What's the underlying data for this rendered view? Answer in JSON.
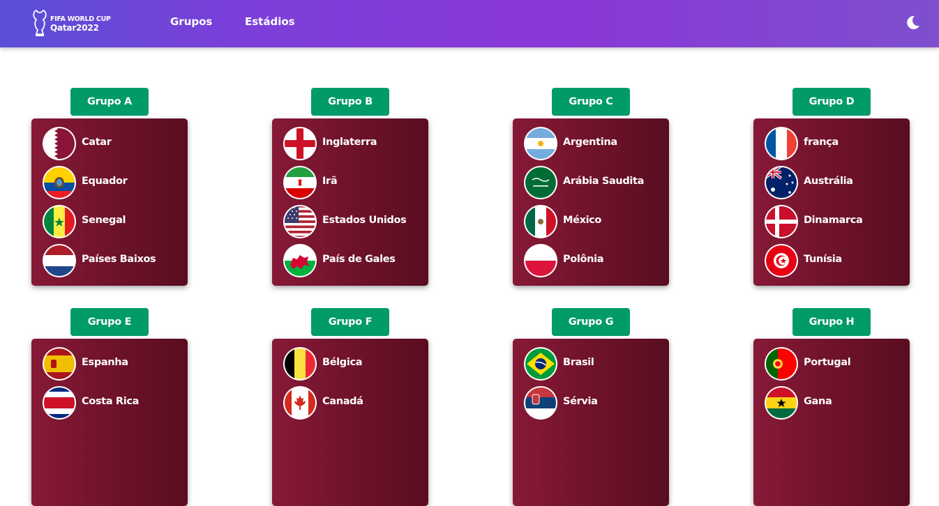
{
  "header": {
    "logo_line1": "FIFA WORLD CUP",
    "logo_line2": "Qatar2022",
    "nav": [
      "Grupos",
      "Estádios"
    ],
    "theme_toggle_icon": "moon-icon"
  },
  "colors": {
    "badge": "#009b69",
    "card": "#7a1430",
    "navbar_start": "#5a4fd6",
    "navbar_end": "#8a37d6"
  },
  "groups": [
    {
      "label": "Grupo A",
      "teams": [
        {
          "name": "Catar",
          "flag": "qatar-flag-icon"
        },
        {
          "name": "Equador",
          "flag": "ecuador-flag-icon"
        },
        {
          "name": "Senegal",
          "flag": "senegal-flag-icon"
        },
        {
          "name": "Países Baixos",
          "flag": "netherlands-flag-icon"
        }
      ]
    },
    {
      "label": "Grupo B",
      "teams": [
        {
          "name": "Inglaterra",
          "flag": "england-flag-icon"
        },
        {
          "name": "Irã",
          "flag": "iran-flag-icon"
        },
        {
          "name": "Estados Unidos",
          "flag": "usa-flag-icon"
        },
        {
          "name": "País de Gales",
          "flag": "wales-flag-icon"
        }
      ]
    },
    {
      "label": "Grupo C",
      "teams": [
        {
          "name": "Argentina",
          "flag": "argentina-flag-icon"
        },
        {
          "name": "Arábia Saudita",
          "flag": "saudi-arabia-flag-icon"
        },
        {
          "name": "México",
          "flag": "mexico-flag-icon"
        },
        {
          "name": "Polônia",
          "flag": "poland-flag-icon"
        }
      ]
    },
    {
      "label": "Grupo D",
      "teams": [
        {
          "name": "frança",
          "flag": "france-flag-icon"
        },
        {
          "name": "Austrália",
          "flag": "australia-flag-icon"
        },
        {
          "name": "Dinamarca",
          "flag": "denmark-flag-icon"
        },
        {
          "name": "Tunísia",
          "flag": "tunisia-flag-icon"
        }
      ]
    },
    {
      "label": "Grupo E",
      "teams": [
        {
          "name": "Espanha",
          "flag": "spain-flag-icon"
        },
        {
          "name": "Costa Rica",
          "flag": "costa-rica-flag-icon"
        }
      ]
    },
    {
      "label": "Grupo F",
      "teams": [
        {
          "name": "Bélgica",
          "flag": "belgium-flag-icon"
        },
        {
          "name": "Canadá",
          "flag": "canada-flag-icon"
        }
      ]
    },
    {
      "label": "Grupo G",
      "teams": [
        {
          "name": "Brasil",
          "flag": "brazil-flag-icon"
        },
        {
          "name": "Sérvia",
          "flag": "serbia-flag-icon"
        }
      ]
    },
    {
      "label": "Grupo H",
      "teams": [
        {
          "name": "Portugal",
          "flag": "portugal-flag-icon"
        },
        {
          "name": "Gana",
          "flag": "ghana-flag-icon"
        }
      ]
    }
  ]
}
